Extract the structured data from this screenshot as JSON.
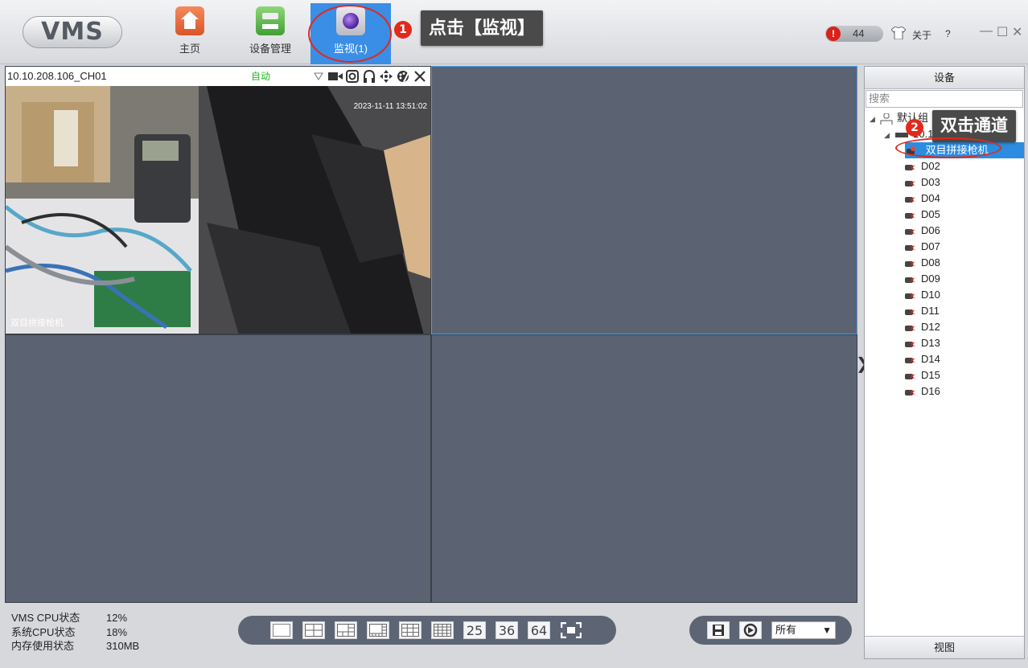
{
  "app": {
    "logo": "VMS"
  },
  "nav": [
    {
      "label": "主页",
      "icon": "home-icon"
    },
    {
      "label": "设备管理",
      "icon": "device-management-icon"
    },
    {
      "label": "监视(1)",
      "icon": "monitor-icon",
      "active": true
    }
  ],
  "annotations": {
    "step1": {
      "number": "1",
      "text": "点击【监视】"
    },
    "step2": {
      "number": "2",
      "text": "双击通道"
    }
  },
  "header_right": {
    "alarm_icon": "!",
    "alarm_count": "44",
    "about": "关于",
    "help": "?",
    "minimize": "—",
    "maximize": "☐",
    "close": "✕"
  },
  "video_cell": {
    "title": "10.10.208.106_CH01",
    "mode": "自动",
    "timestamp": "2023-11-11 13:51:02",
    "osd_text": "双目拼接枪机"
  },
  "panel": {
    "title": "设备",
    "search_placeholder": "搜索",
    "root_group": "默认组",
    "device": "10.10.208.106",
    "selected_channel": "双目拼接枪机",
    "channels": [
      "D02",
      "D03",
      "D04",
      "D05",
      "D06",
      "D07",
      "D08",
      "D09",
      "D10",
      "D11",
      "D12",
      "D13",
      "D14",
      "D15",
      "D16"
    ],
    "footer": "视图",
    "collapse_glyph": "❯"
  },
  "status": [
    {
      "label": "VMS CPU状态",
      "value": "12%"
    },
    {
      "label": "系统CPU状态",
      "value": "18%"
    },
    {
      "label": "内存使用状态",
      "value": "310MB"
    }
  ],
  "layouts": [
    "1",
    "4",
    "6",
    "8",
    "9",
    "16",
    "25",
    "36",
    "64",
    "fullscreen"
  ],
  "layout_labels": {
    "l25": "25",
    "l36": "36",
    "l64": "64"
  },
  "stream_select": "所有",
  "colors": {
    "accent": "#3a8ee6",
    "highlight": "#e2281b",
    "grid_bg": "#5b6372",
    "auto_green": "#23b824"
  }
}
